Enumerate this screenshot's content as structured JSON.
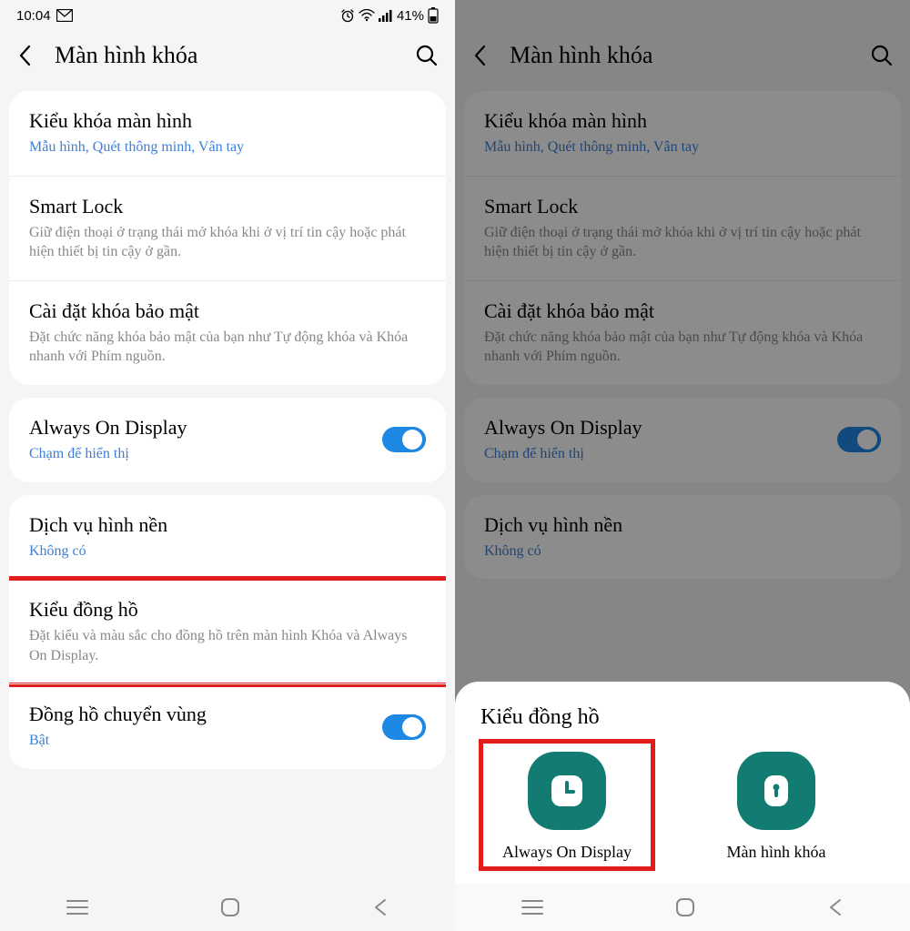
{
  "status": {
    "time": "10:04",
    "battery": "41%"
  },
  "header": {
    "title": "Màn hình khóa"
  },
  "group1": {
    "items": [
      {
        "title": "Kiểu khóa màn hình",
        "sub": "Mẫu hình, Quét thông minh, Vân tay",
        "blue": true
      },
      {
        "title": "Smart Lock",
        "sub": "Giữ điện thoại ở trạng thái mở khóa khi ở vị trí tin cậy hoặc phát hiện thiết bị tin cậy ở gần.",
        "blue": false
      },
      {
        "title": "Cài đặt khóa bảo mật",
        "sub": "Đặt chức năng khóa bảo mật của bạn như Tự động khóa và Khóa nhanh với Phím nguồn.",
        "blue": false
      }
    ]
  },
  "group2": {
    "title": "Always On Display",
    "sub": "Chạm để hiển thị"
  },
  "group3": {
    "items": [
      {
        "title": "Dịch vụ hình nền",
        "sub": "Không có",
        "blue": true
      },
      {
        "title": "Kiểu đồng hồ",
        "sub": "Đặt kiểu và màu sắc cho đồng hồ trên màn hình Khóa và Always On Display.",
        "blue": false
      },
      {
        "title": "Đồng hồ chuyển vùng",
        "sub": "Bật",
        "blue": true,
        "toggle": true
      }
    ]
  },
  "sheet": {
    "title": "Kiểu đồng hồ",
    "options": [
      {
        "label": "Always On Display"
      },
      {
        "label": "Màn hình khóa"
      }
    ]
  }
}
